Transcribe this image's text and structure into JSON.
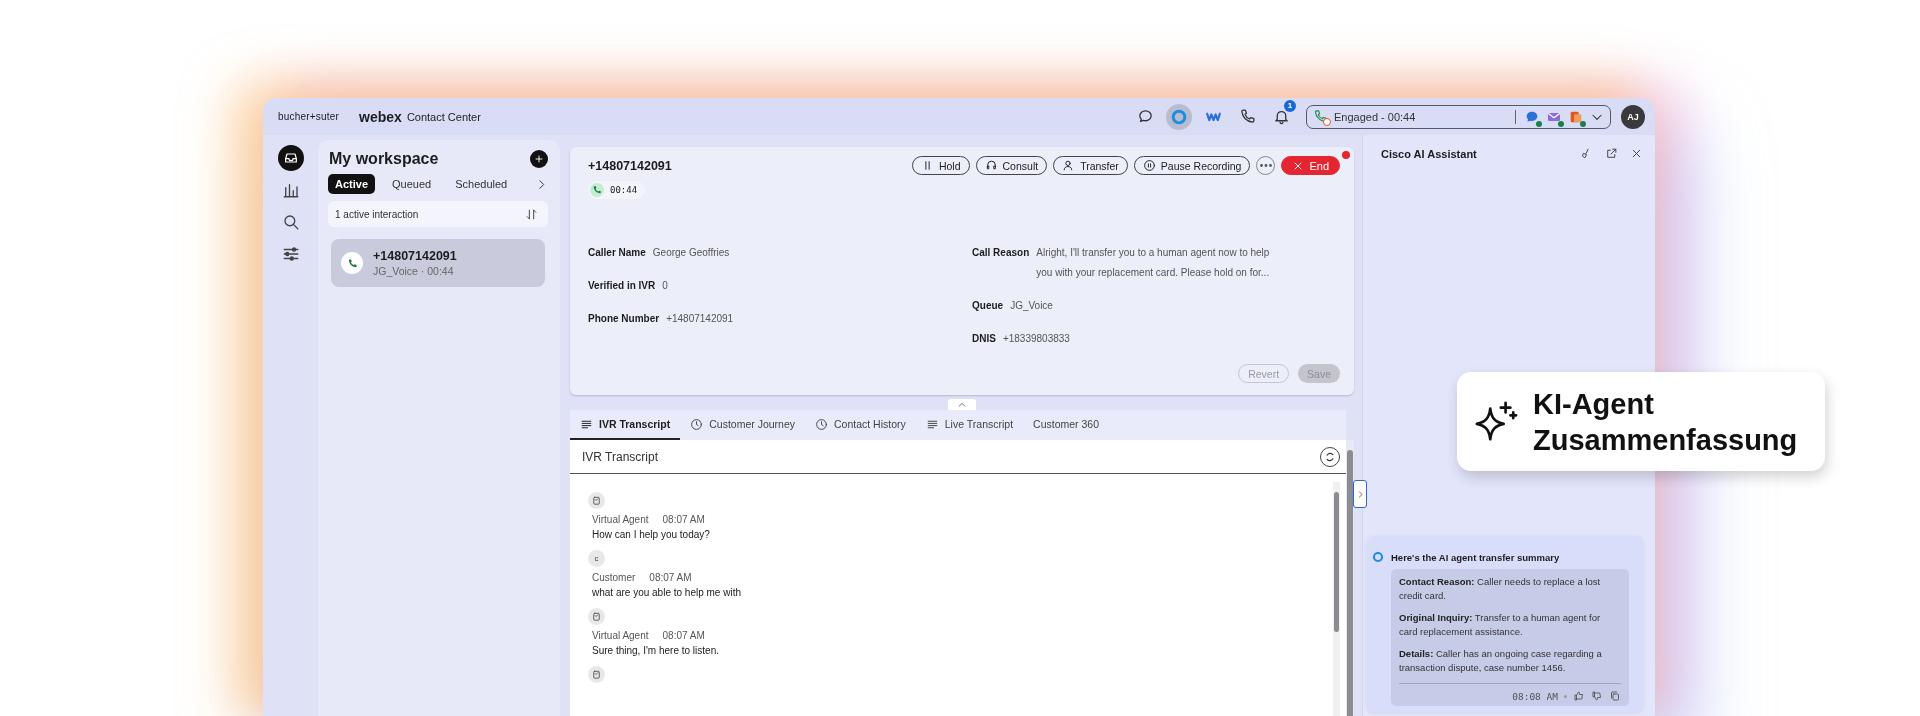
{
  "top_bar": {
    "brand": "bucher+suter",
    "product": "webex",
    "product_suffix": "Contact Center",
    "icons": [
      {
        "kind": "chat",
        "selected": false
      },
      {
        "kind": "ai",
        "selected": true
      },
      {
        "kind": "webex",
        "selected": false
      },
      {
        "kind": "phone",
        "selected": false
      },
      {
        "kind": "bell",
        "selected": false,
        "badge": "1"
      }
    ],
    "status": {
      "text": "Engaged - 00:44",
      "channels": [
        {
          "kind": "chat"
        },
        {
          "kind": "email"
        },
        {
          "kind": "social"
        }
      ]
    },
    "avatar": "AJ"
  },
  "nav_rail": [
    {
      "kind": "inbox",
      "selected": true
    },
    {
      "kind": "chart",
      "selected": false
    },
    {
      "kind": "search",
      "selected": false
    },
    {
      "kind": "sliders",
      "selected": false
    }
  ],
  "workspace": {
    "title": "My workspace",
    "tabs": [
      {
        "label": "Active",
        "selected": true
      },
      {
        "label": "Queued",
        "selected": false
      },
      {
        "label": "Scheduled",
        "selected": false
      }
    ],
    "count_text": "1 active interaction",
    "interactions": [
      {
        "number": "+14807142091",
        "detail": "JG_Voice · 00:44",
        "selected": true
      }
    ]
  },
  "call": {
    "number": "+14807142091",
    "timer": "00:44",
    "buttons": [
      {
        "kind": "hold",
        "label": "Hold"
      },
      {
        "kind": "consult",
        "label": "Consult"
      },
      {
        "kind": "transfer",
        "label": "Transfer"
      },
      {
        "kind": "record",
        "label": "Pause Recording"
      },
      {
        "kind": "more"
      },
      {
        "kind": "end",
        "label": "End"
      }
    ],
    "fields_left": [
      {
        "label": "Caller Name",
        "value": "George Geoffries"
      },
      {
        "label": "Verified in IVR",
        "value": "0"
      },
      {
        "label": "Phone Number",
        "value": "+14807142091"
      }
    ],
    "fields_right": [
      {
        "label": "Call Reason",
        "value": "Alright, I'll transfer you to a human agent now to help you with your replacement card. Please hold on for..."
      },
      {
        "label": "Queue",
        "value": "JG_Voice"
      },
      {
        "label": "DNIS",
        "value": "+18339803833"
      }
    ],
    "actions": [
      {
        "kind": "secondary",
        "label": "Revert",
        "disabled": true
      },
      {
        "kind": "primary",
        "label": "Save",
        "disabled": true
      }
    ]
  },
  "detail_tabs": [
    {
      "kind": "list",
      "label": "IVR Transcript",
      "selected": true
    },
    {
      "kind": "clock",
      "label": "Customer Journey",
      "selected": false
    },
    {
      "kind": "clock",
      "label": "Contact History",
      "selected": false
    },
    {
      "kind": "list",
      "label": "Live Transcript",
      "selected": false
    },
    {
      "kind": "plain",
      "label": "Customer 360",
      "selected": false
    }
  ],
  "transcript": {
    "title": "IVR Transcript",
    "messages": [
      {
        "kind": "agent",
        "speaker": "Virtual Agent",
        "time": "08:07 AM",
        "text": "How can I help you today?"
      },
      {
        "kind": "customer",
        "avatar_letter": "c",
        "speaker": "Customer",
        "time": "08:07 AM",
        "text": "what are you able to help me with"
      },
      {
        "kind": "agent",
        "speaker": "Virtual Agent",
        "time": "08:07 AM",
        "text": "Sure thing, I'm here to listen."
      },
      {
        "kind": "agent"
      }
    ]
  },
  "assistant": {
    "title": "Cisco AI Assistant",
    "summary": {
      "heading": "Here's the AI agent transfer summary",
      "items": [
        "**Contact Reason:** Caller needs to replace a lost credit card.",
        "**Original Inquiry:** Transfer to a human agent for card replacement assistance.",
        "**Details:** Caller has an ongoing case regarding a transaction dispute, case number 1456."
      ],
      "time": "08:08 AM"
    }
  },
  "callout": {
    "text": "KI-Agent Zusammenfassung"
  }
}
